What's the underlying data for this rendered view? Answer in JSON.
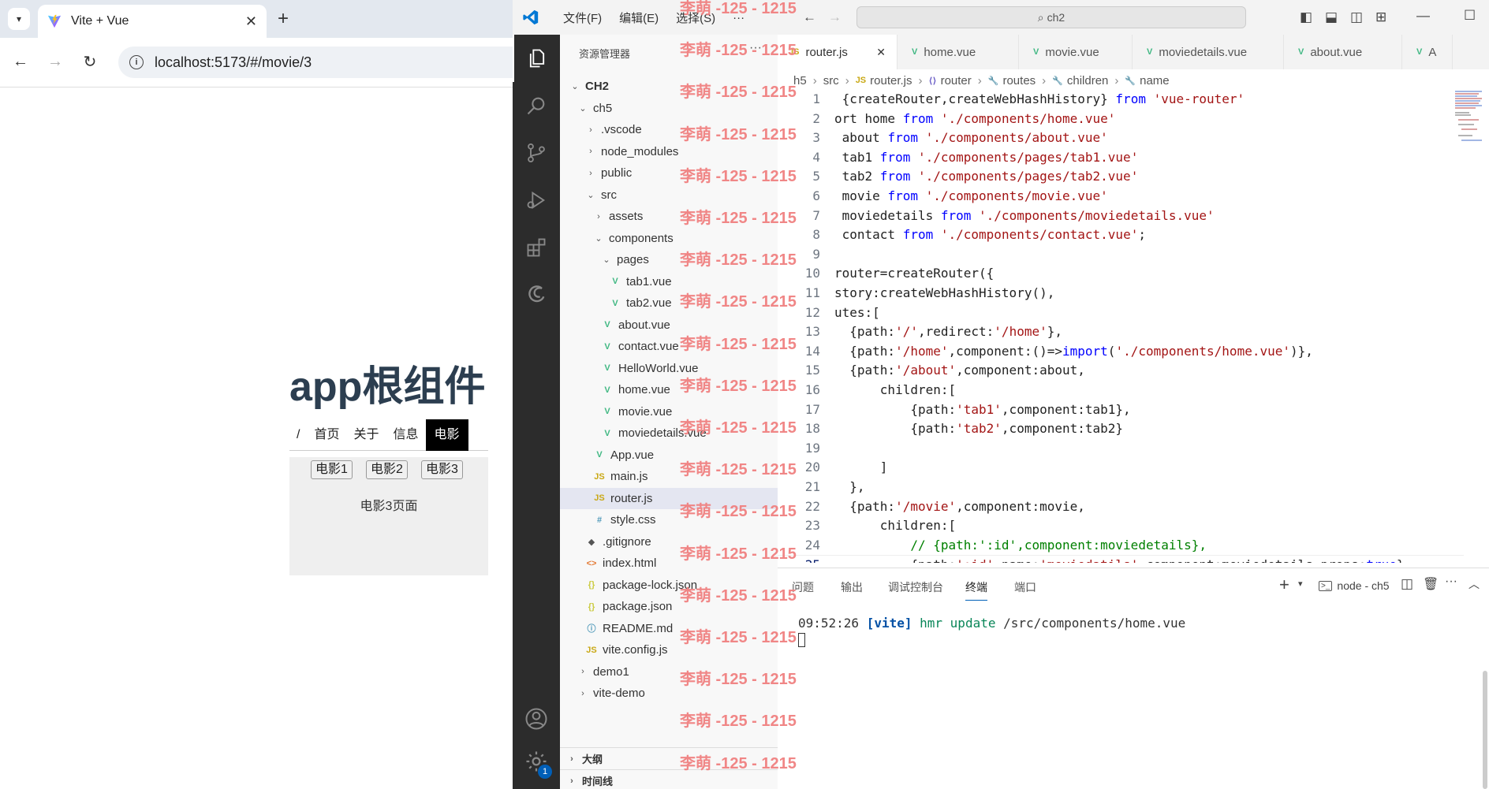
{
  "browser": {
    "tab_title": "Vite + Vue",
    "url": "localhost:5173/#/movie/3"
  },
  "page": {
    "title": "app根组件",
    "nav": [
      "/",
      "首页",
      "关于",
      "信息",
      "电影"
    ],
    "movie_buttons": [
      "电影1",
      "电影2",
      "电影3"
    ],
    "movie_text": "电影3页面"
  },
  "vscode": {
    "menu": [
      "文件(F)",
      "编辑(E)",
      "选择(S)",
      "···"
    ],
    "search": "ch2",
    "explorer_title": "资源管理器",
    "tree": [
      {
        "label": "CH2",
        "type": "root"
      },
      {
        "label": "ch5",
        "type": "folder-open"
      },
      {
        "label": ".vscode",
        "type": "folder"
      },
      {
        "label": "node_modules",
        "type": "folder"
      },
      {
        "label": "public",
        "type": "folder"
      },
      {
        "label": "src",
        "type": "folder-open"
      },
      {
        "label": "assets",
        "type": "folder"
      },
      {
        "label": "components",
        "type": "folder-open"
      },
      {
        "label": "pages",
        "type": "folder-open"
      },
      {
        "label": "tab1.vue",
        "type": "vue"
      },
      {
        "label": "tab2.vue",
        "type": "vue"
      },
      {
        "label": "about.vue",
        "type": "vue"
      },
      {
        "label": "contact.vue",
        "type": "vue"
      },
      {
        "label": "HelloWorld.vue",
        "type": "vue"
      },
      {
        "label": "home.vue",
        "type": "vue"
      },
      {
        "label": "movie.vue",
        "type": "vue"
      },
      {
        "label": "moviedetails.vue",
        "type": "vue"
      },
      {
        "label": "App.vue",
        "type": "vue"
      },
      {
        "label": "main.js",
        "type": "js"
      },
      {
        "label": "router.js",
        "type": "js"
      },
      {
        "label": "style.css",
        "type": "css"
      },
      {
        "label": ".gitignore",
        "type": "git"
      },
      {
        "label": "index.html",
        "type": "html"
      },
      {
        "label": "package-lock.json",
        "type": "json"
      },
      {
        "label": "package.json",
        "type": "json"
      },
      {
        "label": "README.md",
        "type": "info"
      },
      {
        "label": "vite.config.js",
        "type": "js"
      },
      {
        "label": "demo1",
        "type": "folder"
      },
      {
        "label": "vite-demo",
        "type": "folder"
      }
    ],
    "outline": "大纲",
    "timeline": "时间线",
    "tabs": [
      "router.js",
      "home.vue",
      "movie.vue",
      "moviedetails.vue",
      "about.vue",
      "A"
    ],
    "breadcrumbs": [
      "h5",
      "src",
      "router.js",
      "router",
      "routes",
      "children",
      "name"
    ],
    "code_lines": [
      " {createRouter,createWebHashHistory} from 'vue-router'",
      "ort home from './components/home.vue'",
      " about from './components/about.vue'",
      " tab1 from './components/pages/tab1.vue'",
      " tab2 from './components/pages/tab2.vue'",
      " movie from './components/movie.vue'",
      " moviedetails from './components/moviedetails.vue'",
      " contact from './components/contact.vue';",
      "",
      "router=createRouter({",
      "story:createWebHashHistory(),",
      "utes:[",
      "  {path:'/',redirect:'/home'},",
      "  {path:'/home',component:()=>import('./components/home.vue')},",
      "  {path:'/about',component:about,",
      "      children:[",
      "          {path:'tab1',component:tab1},",
      "          {path:'tab2',component:tab2}",
      "",
      "      ]",
      "  },",
      "  {path:'/movie',component:movie,",
      "      children:[",
      "          // {path:':id',component:moviedetails},",
      "          {path:':id',name:'moviedatils',component:moviedetails,props:true},"
    ],
    "current_line": 25,
    "panel_tabs": [
      "问题",
      "输出",
      "调试控制台",
      "终端",
      "端口"
    ],
    "active_panel_tab": "终端",
    "terminal_name": "node - ch5",
    "terminal_time": "09:52:26",
    "terminal_tag": "[vite]",
    "terminal_msg": "hmr update",
    "terminal_path": "/src/components/home.vue",
    "account_badge": "1"
  },
  "watermark": "李萌 -125 - 1215"
}
